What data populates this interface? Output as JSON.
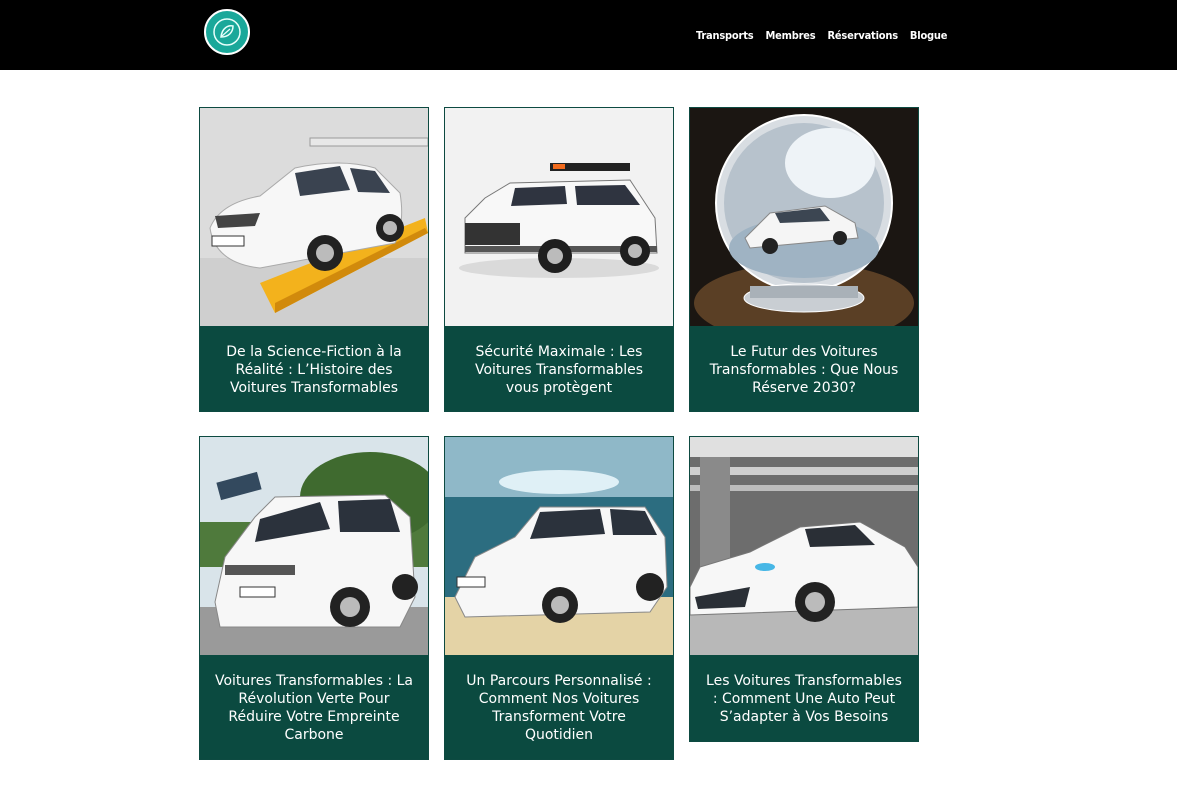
{
  "header": {
    "nav": [
      "Transports",
      "Membres",
      "Réservations",
      "Blogue"
    ]
  },
  "cards": [
    {
      "title": "De la Science-Fiction à la Réalité : L’Histoire des Voitures Transformables",
      "image": "white-sedan-on-platform"
    },
    {
      "title": "Sécurité Maximale : Les Voitures Transformables vous protègent",
      "image": "white-suv-with-lightbar"
    },
    {
      "title": "Le Futur des Voitures Transformables : Que Nous Réserve 2030?",
      "image": "car-in-crystal-ball"
    },
    {
      "title": "Voitures Transformables : La Révolution Verte Pour Réduire Votre Empreinte Carbone",
      "image": "white-minivan-with-solar-panels"
    },
    {
      "title": "Un Parcours Personnalisé : Comment Nos Voitures Transforment Votre Quotidien",
      "image": "white-suv-underwater"
    },
    {
      "title": "Les Voitures Transformables : Comment Une Auto Peut S’adapter à Vos Besoins",
      "image": "white-sports-car-in-tunnel"
    }
  ],
  "colors": {
    "brand": "#0b4a40",
    "logo": "#1aa89a",
    "header_bg": "#000000"
  }
}
